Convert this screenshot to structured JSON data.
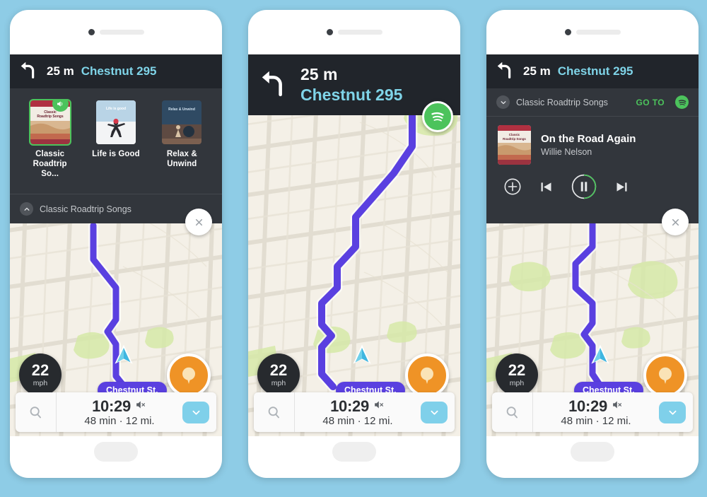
{
  "theme": {
    "page_background": "#8ecce6",
    "nav_header_bg": "#21252b",
    "panel_bg": "#32363c",
    "street_color": "#7fd4e8",
    "route_color": "#5a40e0",
    "spotify_green": "#4cc35c",
    "map_background": "#f4f0e7",
    "pin_orange": "#ef9326",
    "eta_chevron_blue": "#7fd0ea"
  },
  "navigation": {
    "distance": "25 m",
    "street": "Chestnut 295",
    "turn_icon": "turn-left-icon"
  },
  "playlists": [
    {
      "title": "Classic Roadtrip So...",
      "art_title": "Classic Roadtrip Songs",
      "selected": true,
      "badge_icon": "speaker-icon"
    },
    {
      "title": "Life is Good",
      "art_title": "Life is good",
      "selected": false,
      "badge_icon": ""
    },
    {
      "title": "Relax & Unwind",
      "art_title": "Relax & Unwind",
      "selected": false,
      "badge_icon": ""
    }
  ],
  "playlist_bar": {
    "name": "Classic Roadtrip Songs",
    "collapse_icon": "chevron-up-icon",
    "expand_icon": "chevron-down-icon"
  },
  "player": {
    "playlist_name": "Classic Roadtrip Songs",
    "goto_label": "GO TO",
    "spotify_icon": "spotify-icon",
    "track_title": "On the Road Again",
    "track_artist": "Willie Nelson",
    "album_art_title": "Classic Roadtrip Songs",
    "controls": {
      "add": "plus-icon",
      "previous": "skip-previous-icon",
      "play_pause": "pause-icon",
      "next": "skip-next-icon"
    }
  },
  "close_button": {
    "icon": "close-icon"
  },
  "spotify_fab": {
    "icon": "spotify-icon"
  },
  "map": {
    "speed": {
      "value": "22",
      "unit": "mph"
    },
    "street_label": "Chestnut St.",
    "destination_icon": "destination-pin-icon",
    "car_icon": "navigation-arrow-icon"
  },
  "eta_bar": {
    "search_icon": "search-icon",
    "arrival_time": "10:29",
    "mute_icon": "speaker-muted-icon",
    "duration_distance": "48 min · 12 mi.",
    "expand_icon": "chevron-down-icon"
  }
}
